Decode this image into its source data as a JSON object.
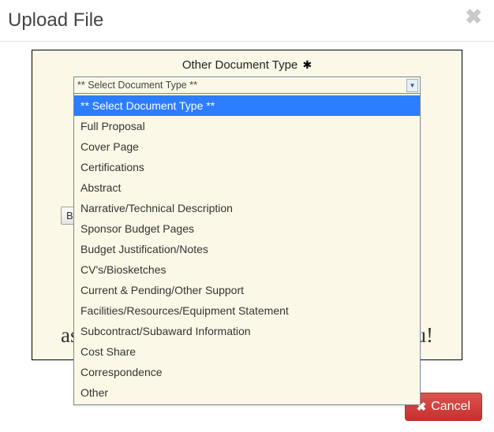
{
  "header": {
    "title": "Upload File"
  },
  "panel": {
    "label": "Other Document Type",
    "required_glyph": "✱"
  },
  "select": {
    "current": "** Select Document Type **",
    "options": [
      "** Select Document Type **",
      "Full Proposal",
      "Cover Page",
      "Certifications",
      "Abstract",
      "Narrative/Technical Description",
      "Sponsor Budget Pages",
      "Budget Justification/Notes",
      "CV's/Biosketches",
      "Current & Pending/Other Support",
      "Facilities/Resources/Equipment Statement",
      "Subcontract/Subaward Information",
      "Cost Share",
      "Correspondence",
      "Other"
    ],
    "selected_index": 0
  },
  "browse": {
    "label_fragment": "Br"
  },
  "background_text": {
    "left": "as",
    "right": "u!"
  },
  "footer": {
    "cancel_label": "Cancel"
  }
}
